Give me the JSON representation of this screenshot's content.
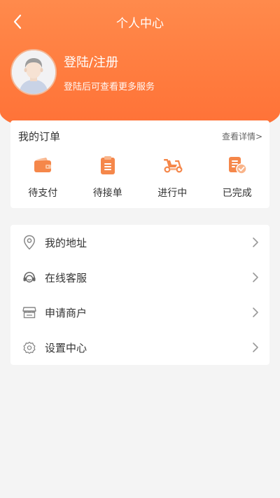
{
  "nav": {
    "title": "个人中心"
  },
  "profile": {
    "title": "登陆/注册",
    "subtitle": "登陆后可查看更多服务"
  },
  "orders": {
    "title": "我的订单",
    "more": "查看详情>",
    "items": [
      {
        "label": "待支付",
        "icon": "wallet-icon"
      },
      {
        "label": "待接单",
        "icon": "clipboard-icon"
      },
      {
        "label": "进行中",
        "icon": "scooter-icon"
      },
      {
        "label": "已完成",
        "icon": "completed-doc-icon"
      }
    ]
  },
  "menu": [
    {
      "label": "我的地址",
      "icon": "location-pin-icon"
    },
    {
      "label": "在线客服",
      "icon": "customer-service-icon"
    },
    {
      "label": "申请商户",
      "icon": "store-icon"
    },
    {
      "label": "设置中心",
      "icon": "gear-icon"
    }
  ],
  "colors": {
    "accent": "#ff7a3d",
    "icon_orange": "#f5874a",
    "icon_gray": "#888888"
  }
}
